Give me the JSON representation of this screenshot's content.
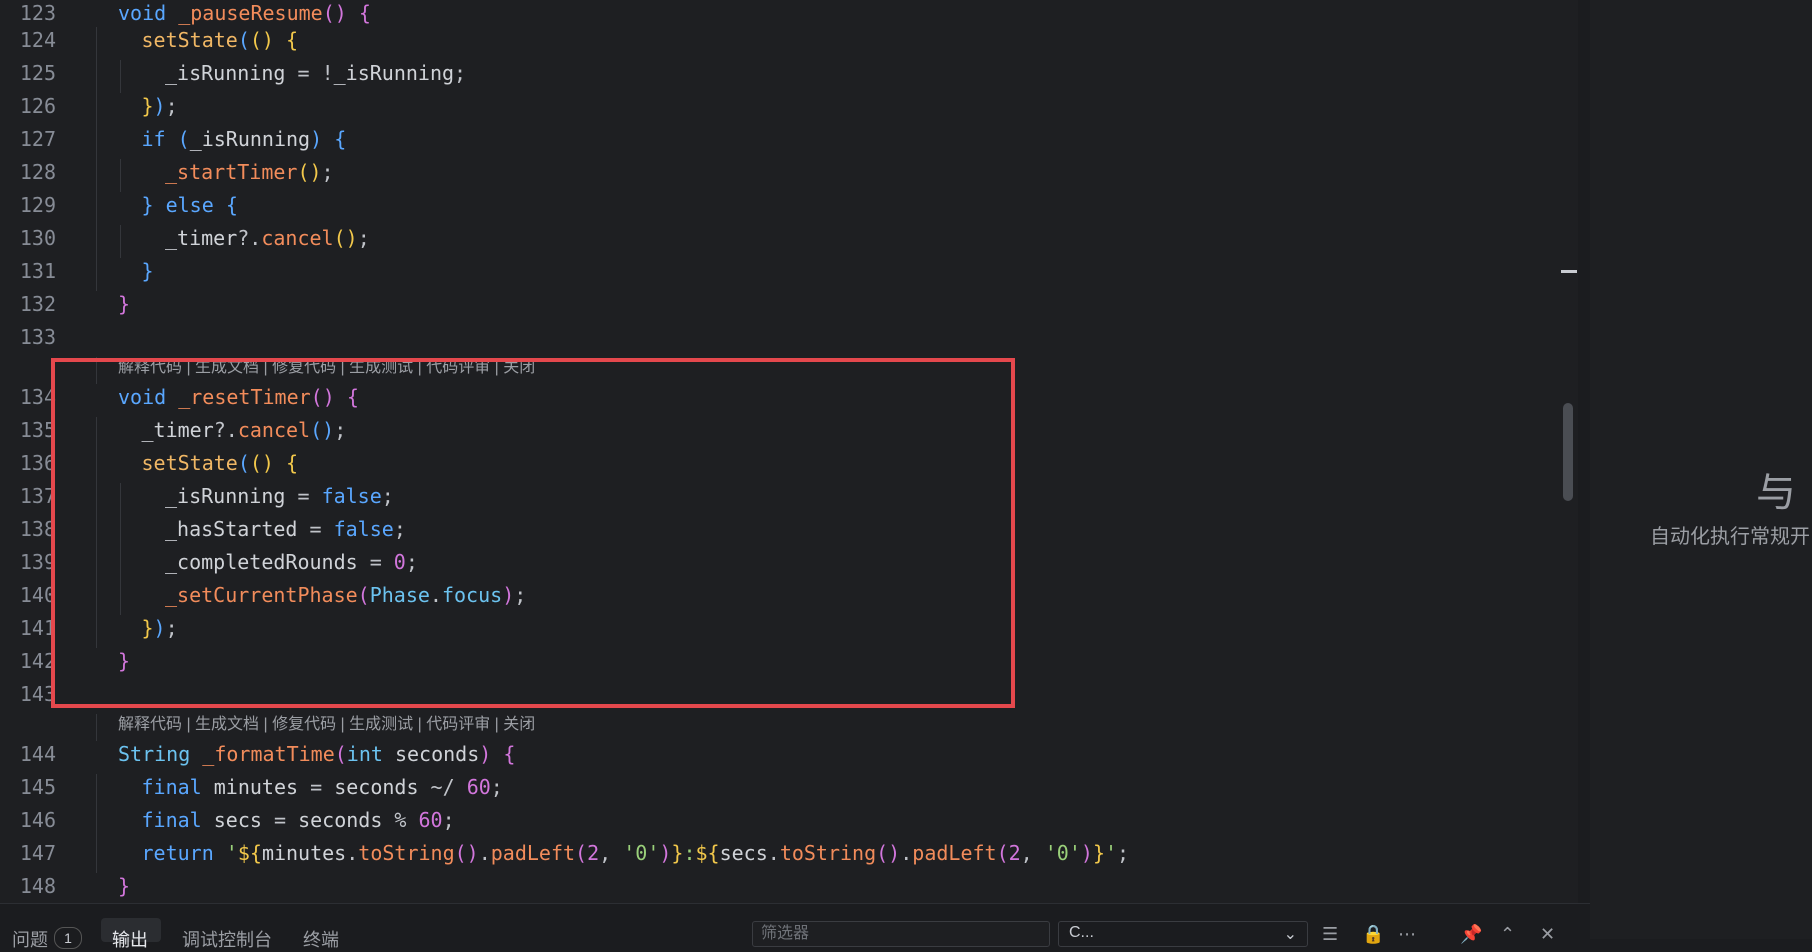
{
  "editor": {
    "codelens": "解释代码 | 生成文档 | 修复代码 | 生成测试 | 代码评审 | 关闭",
    "lines": [
      {
        "n": "123",
        "indent": 1,
        "html": "<span class='tok-kw'>void</span> <span class='tok-fn'>_pauseResume</span><span class='tok-b2'>()</span> <span class='tok-b2'>{</span>"
      },
      {
        "n": "124",
        "indent": 2,
        "html": "<span class='tok-call'>setState</span><span class='tok-b3'>(</span><span class='tok-b1'>()</span> <span class='tok-b1'>{</span>"
      },
      {
        "n": "125",
        "indent": 3,
        "html": "<span class='tok-id'>_isRunning</span> <span class='tok-pun'>=</span> <span class='tok-pun'>!</span><span class='tok-id'>_isRunning</span><span class='tok-pun'>;</span>"
      },
      {
        "n": "126",
        "indent": 2,
        "html": "<span class='tok-b1'>}</span><span class='tok-b3'>)</span><span class='tok-pun'>;</span>"
      },
      {
        "n": "127",
        "indent": 2,
        "html": "<span class='tok-kw'>if</span> <span class='tok-b3'>(</span><span class='tok-id'>_isRunning</span><span class='tok-b3'>)</span> <span class='tok-b3'>{</span>"
      },
      {
        "n": "128",
        "indent": 3,
        "html": "<span class='tok-fn'>_startTimer</span><span class='tok-b1'>()</span><span class='tok-pun'>;</span>"
      },
      {
        "n": "129",
        "indent": 2,
        "html": "<span class='tok-b3'>}</span> <span class='tok-kw'>else</span> <span class='tok-b3'>{</span>"
      },
      {
        "n": "130",
        "indent": 3,
        "html": "<span class='tok-id'>_timer</span><span class='tok-pun'>?.</span><span class='tok-fn'>cancel</span><span class='tok-b1'>()</span><span class='tok-pun'>;</span>"
      },
      {
        "n": "131",
        "indent": 2,
        "html": "<span class='tok-b3'>}</span>"
      },
      {
        "n": "132",
        "indent": 1,
        "html": "<span class='tok-b2'>}</span>"
      },
      {
        "n": "133",
        "indent": 1,
        "html": "",
        "lens_after": true
      },
      {
        "n": "134",
        "indent": 1,
        "html": "<span class='tok-kw'>void</span> <span class='tok-fn'>_resetTimer</span><span class='tok-b2'>()</span> <span class='tok-b2'>{</span>"
      },
      {
        "n": "135",
        "indent": 2,
        "html": "<span class='tok-id'>_timer</span><span class='tok-pun'>?.</span><span class='tok-fn'>cancel</span><span class='tok-b3'>()</span><span class='tok-pun'>;</span>"
      },
      {
        "n": "136",
        "indent": 2,
        "html": "<span class='tok-call'>setState</span><span class='tok-b3'>(</span><span class='tok-b1'>()</span> <span class='tok-b1'>{</span>"
      },
      {
        "n": "137",
        "indent": 3,
        "html": "<span class='tok-id'>_isRunning</span> <span class='tok-pun'>=</span> <span class='tok-kw'>false</span><span class='tok-pun'>;</span>"
      },
      {
        "n": "138",
        "indent": 3,
        "html": "<span class='tok-id'>_hasStarted</span> <span class='tok-pun'>=</span> <span class='tok-kw'>false</span><span class='tok-pun'>;</span>"
      },
      {
        "n": "139",
        "indent": 3,
        "html": "<span class='tok-id'>_completedRounds</span> <span class='tok-pun'>=</span> <span class='tok-num'>0</span><span class='tok-pun'>;</span>"
      },
      {
        "n": "140",
        "indent": 3,
        "html": "<span class='tok-fn'>_setCurrentPhase</span><span class='tok-b2'>(</span><span class='tok-type'>Phase</span><span class='tok-pun'>.</span><span class='tok-type'>focus</span><span class='tok-b2'>)</span><span class='tok-pun'>;</span>"
      },
      {
        "n": "141",
        "indent": 2,
        "html": "<span class='tok-b1'>}</span><span class='tok-b3'>)</span><span class='tok-pun'>;</span>"
      },
      {
        "n": "142",
        "indent": 1,
        "html": "<span class='tok-b2'>}</span>"
      },
      {
        "n": "143",
        "indent": 1,
        "html": "",
        "lens_after": true
      },
      {
        "n": "144",
        "indent": 1,
        "html": "<span class='tok-type'>String</span> <span class='tok-fn'>_formatTime</span><span class='tok-b2'>(</span><span class='tok-type'>int</span> <span class='tok-id'>seconds</span><span class='tok-b2'>)</span> <span class='tok-b2'>{</span>"
      },
      {
        "n": "145",
        "indent": 2,
        "html": "<span class='tok-kw'>final</span> <span class='tok-id'>minutes</span> <span class='tok-pun'>=</span> <span class='tok-id'>seconds</span> <span class='tok-pun'>~/</span> <span class='tok-num'>60</span><span class='tok-pun'>;</span>"
      },
      {
        "n": "146",
        "indent": 2,
        "html": "<span class='tok-kw'>final</span> <span class='tok-id'>secs</span> <span class='tok-pun'>=</span> <span class='tok-id'>seconds</span> <span class='tok-pun'>%</span> <span class='tok-num'>60</span><span class='tok-pun'>;</span>"
      },
      {
        "n": "147",
        "indent": 2,
        "html": "<span class='tok-kw'>return</span> <span class='tok-str'>'</span><span class='tok-b1'>${</span><span class='tok-id'>minutes</span><span class='tok-pun'>.</span><span class='tok-fn'>toString</span><span class='tok-b2'>()</span><span class='tok-pun'>.</span><span class='tok-fn'>padLeft</span><span class='tok-b2'>(</span><span class='tok-num'>2</span><span class='tok-pun'>,</span> <span class='tok-str'>'0'</span><span class='tok-b2'>)</span><span class='tok-b1'>}</span><span class='tok-str'>:</span><span class='tok-b1'>${</span><span class='tok-id'>secs</span><span class='tok-pun'>.</span><span class='tok-fn'>toString</span><span class='tok-b2'>()</span><span class='tok-pun'>.</span><span class='tok-fn'>padLeft</span><span class='tok-b2'>(</span><span class='tok-num'>2</span><span class='tok-pun'>,</span> <span class='tok-str'>'0'</span><span class='tok-b2'>)</span><span class='tok-b1'>}</span><span class='tok-str'>'</span><span class='tok-pun'>;</span>"
      },
      {
        "n": "148",
        "indent": 1,
        "html": "<span class='tok-b2'>}</span>"
      }
    ]
  },
  "side_panel": {
    "glyph": "与",
    "text": "自动化执行常规开"
  },
  "bottom_panel": {
    "tabs": [
      {
        "label": "问题",
        "active": false
      },
      {
        "label": "输出",
        "active": true
      },
      {
        "label": "调试控制台",
        "active": false
      },
      {
        "label": "终端",
        "active": false
      }
    ],
    "problems_count": "1",
    "filter_placeholder": "筛选器",
    "channel_value": "C..."
  },
  "colors": {
    "highlight_box": "#e5484d",
    "background": "#1e1f22"
  }
}
